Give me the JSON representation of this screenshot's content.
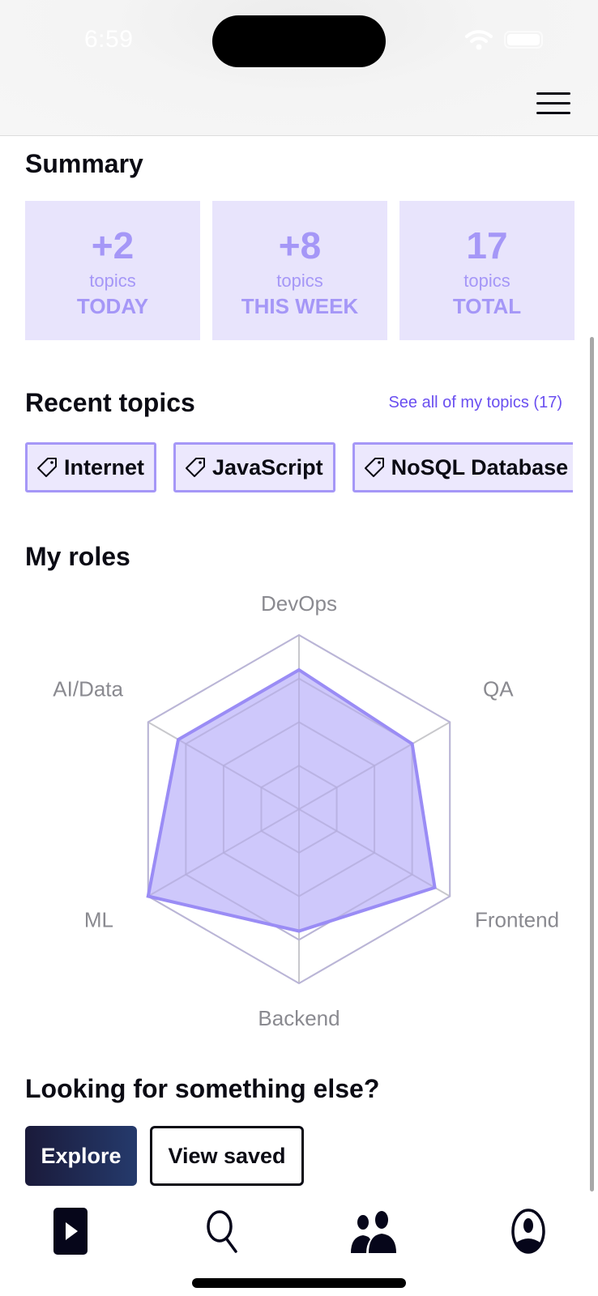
{
  "status_bar": {
    "time": "6:59"
  },
  "summary": {
    "title": "Summary",
    "cards": [
      {
        "value": "+2",
        "unit": "topics",
        "period": "TODAY"
      },
      {
        "value": "+8",
        "unit": "topics",
        "period": "THIS WEEK"
      },
      {
        "value": "17",
        "unit": "topics",
        "period": "TOTAL"
      }
    ]
  },
  "recent_topics": {
    "title": "Recent topics",
    "see_all_label": "See all of my topics (17)",
    "chips": [
      {
        "label": "Internet",
        "icon": "tag-icon"
      },
      {
        "label": "JavaScript",
        "icon": "tag-icon"
      },
      {
        "label": "NoSQL Database",
        "icon": "tag-icon"
      }
    ]
  },
  "roles": {
    "title": "My roles"
  },
  "chart_data": {
    "type": "radar",
    "title": "My roles",
    "axes": [
      "DevOps",
      "QA",
      "Frontend",
      "Backend",
      "ML",
      "AI/Data"
    ],
    "series": [
      {
        "name": "My roles",
        "values": [
          0.8,
          0.75,
          0.9,
          0.7,
          1.0,
          0.8
        ]
      }
    ],
    "range": [
      0,
      1
    ],
    "rings": 4,
    "colors": {
      "fill": "#c9c2fb",
      "stroke": "#9a8cf5",
      "grid": "#c8c8cc"
    }
  },
  "cta": {
    "title": "Looking for something else?",
    "explore_label": "Explore",
    "view_saved_label": "View saved"
  },
  "nav": {
    "items": [
      {
        "name": "play",
        "icon": "play-icon"
      },
      {
        "name": "search",
        "icon": "search-icon"
      },
      {
        "name": "community",
        "icon": "people-icon"
      },
      {
        "name": "profile",
        "icon": "profile-icon"
      }
    ]
  }
}
